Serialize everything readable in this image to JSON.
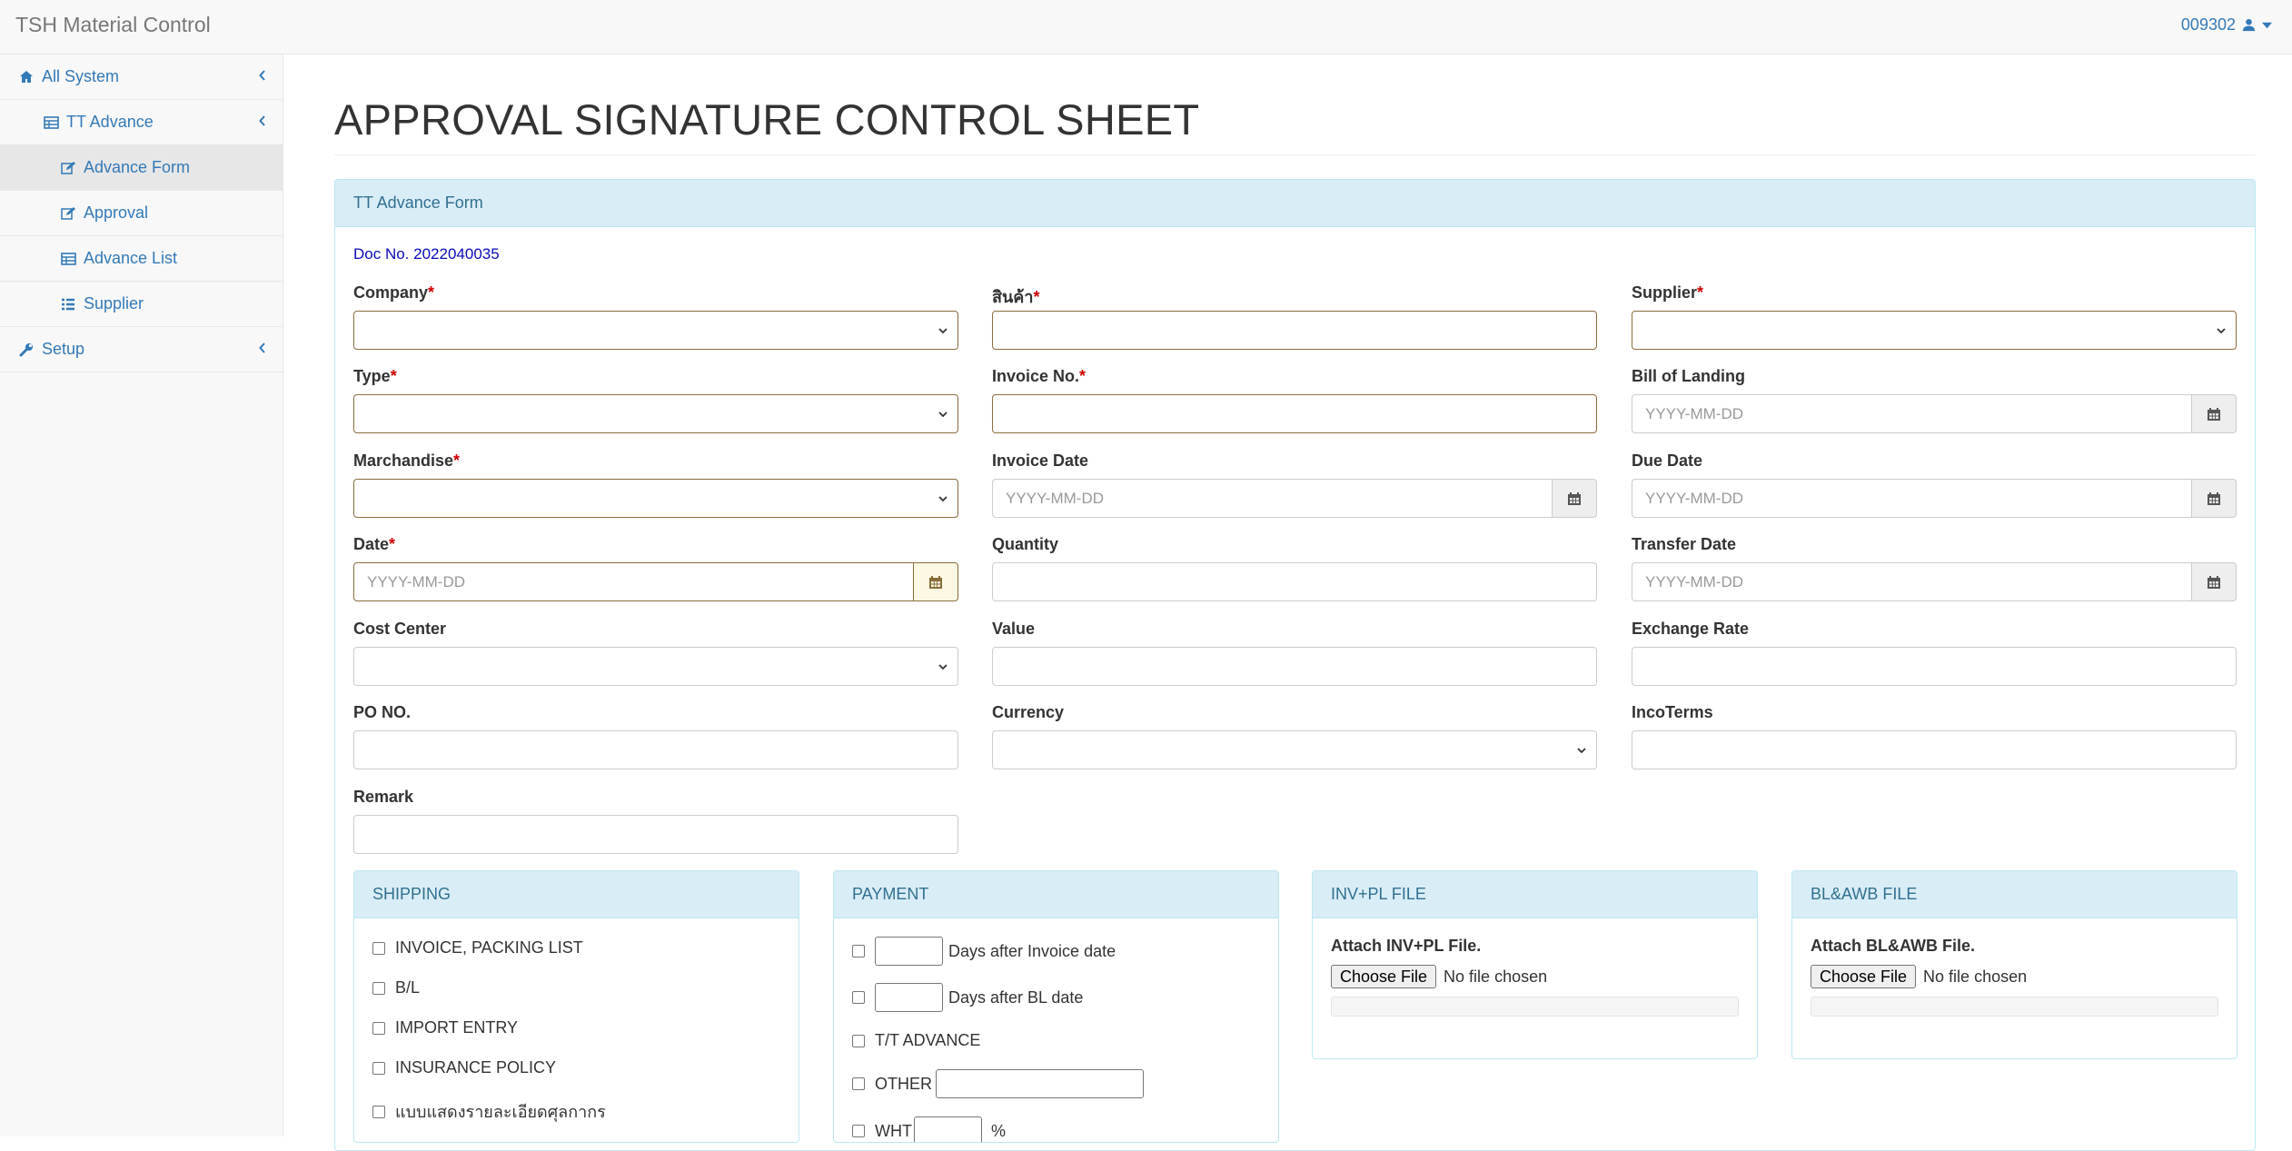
{
  "app": {
    "brand": "TSH Material Control",
    "user": "009302"
  },
  "sidebar": {
    "items": [
      {
        "label": "All System"
      },
      {
        "label": "TT Advance"
      },
      {
        "label": "Advance Form"
      },
      {
        "label": "Approval"
      },
      {
        "label": "Advance List"
      },
      {
        "label": "Supplier"
      },
      {
        "label": "Setup"
      }
    ]
  },
  "page": {
    "title": "APPROVAL SIGNATURE CONTROL SHEET"
  },
  "form": {
    "panel_title": "TT Advance Form",
    "doc_no": "Doc No. 2022040035",
    "required_mark": "*",
    "date_placeholder": "YYYY-MM-DD",
    "labels": {
      "company": "Company",
      "product": "สินค้า",
      "supplier": "Supplier",
      "type": "Type",
      "invoice_no": "Invoice No.",
      "bill_of_landing": "Bill of Landing",
      "marchandise": "Marchandise",
      "invoice_date": "Invoice Date",
      "due_date": "Due Date",
      "date": "Date",
      "quantity": "Quantity",
      "transfer_date": "Transfer Date",
      "cost_center": "Cost Center",
      "value": "Value",
      "exchange_rate": "Exchange Rate",
      "po_no": "PO NO.",
      "currency": "Currency",
      "incoterms": "IncoTerms",
      "remark": "Remark"
    }
  },
  "shipping": {
    "title": "SHIPPING",
    "items": [
      "INVOICE, PACKING LIST",
      "B/L",
      "IMPORT ENTRY",
      "INSURANCE POLICY",
      "แบบแสดงรายละเอียดศุลกากร"
    ]
  },
  "payment": {
    "title": "PAYMENT",
    "days_invoice": "Days after Invoice date",
    "days_bl": "Days after BL date",
    "tt_advance": "T/T ADVANCE",
    "other": "OTHER",
    "wht": "WHT",
    "percent": "%"
  },
  "inv_pl": {
    "title": "INV+PL FILE",
    "attach_label": "Attach INV+PL File.",
    "button": "Choose File",
    "status": "No file chosen"
  },
  "bl_awb": {
    "title": "BL&AWB FILE",
    "attach_label": "Attach BL&AWB File.",
    "button": "Choose File",
    "status": "No file chosen"
  }
}
